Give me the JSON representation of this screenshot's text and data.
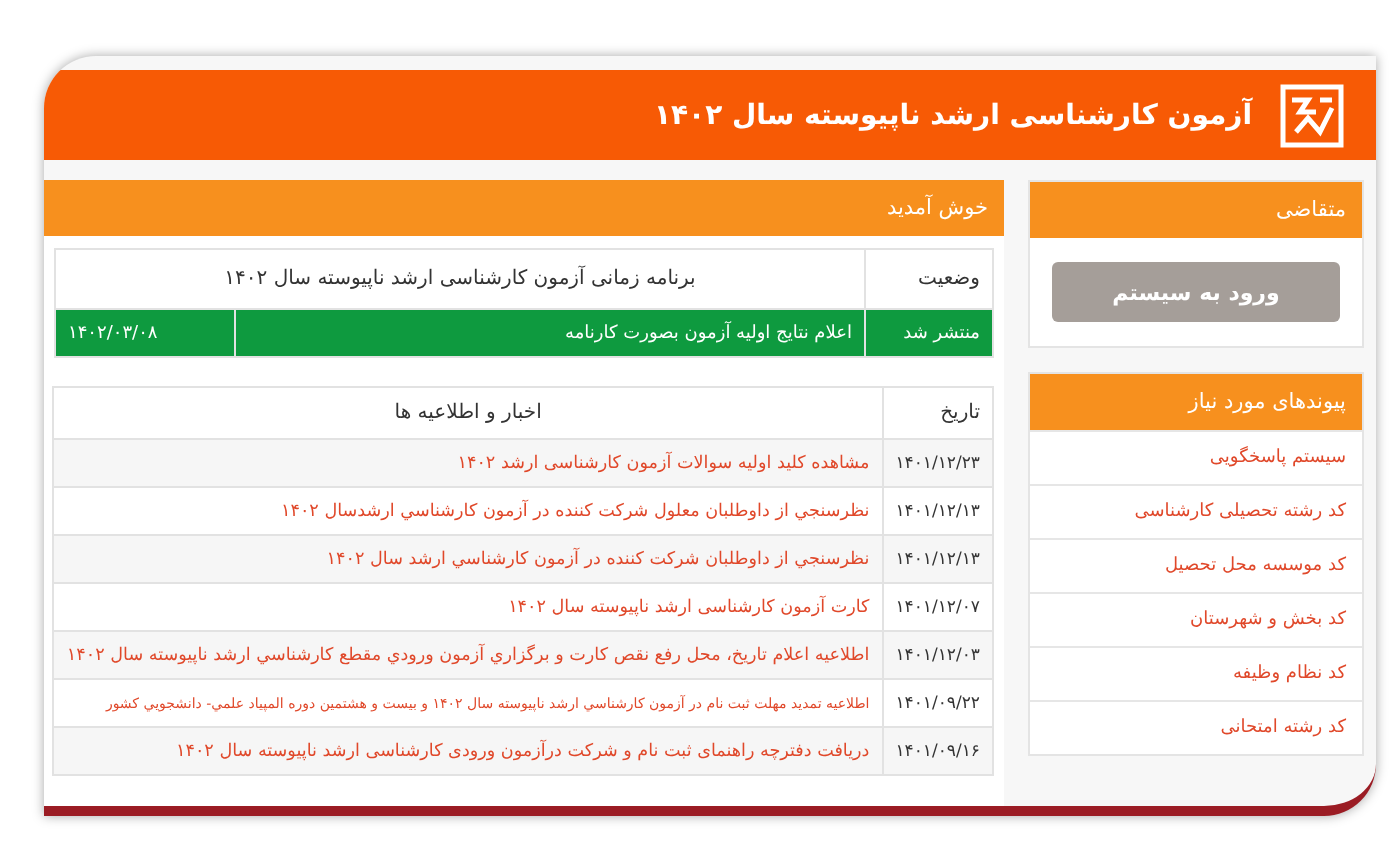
{
  "header": {
    "title": "آزمون کارشناسی ارشد ناپیوسته سال ۱۴۰۲"
  },
  "sidebar": {
    "applicant_panel": {
      "title": "متقاضی",
      "login_button": "ورود به سیستم"
    },
    "links_panel": {
      "title": "پیوندهای مورد نیاز",
      "links": [
        "سیستم پاسخگویی",
        "کد رشته تحصیلی کارشناسی",
        "کد موسسه محل تحصیل",
        "کد بخش و شهرستان",
        "کد نظام وظیفه",
        "کد رشته امتحانی"
      ]
    }
  },
  "main": {
    "title": "خوش آمدید",
    "schedule": {
      "status_label": "وضعیت",
      "heading": "برنامه زمانی آزمون کارشناسی ارشد ناپیوسته سال ۱۴۰۲",
      "rows": [
        {
          "status": "منتشر شد",
          "event": "اعلام نتایج اولیه آزمون بصورت کارنامه",
          "date": "۱۴۰۲/۰۳/۰۸",
          "published": true
        }
      ]
    },
    "news": {
      "columns": [
        "تاریخ",
        "اخبار و اطلاعیه ها"
      ],
      "rows": [
        {
          "date": "۱۴۰۱/۱۲/۲۳",
          "title": "مشاهده کلید اولیه سوالات آزمون کارشناسی ارشد ۱۴۰۲"
        },
        {
          "date": "۱۴۰۱/۱۲/۱۳",
          "title": "نظرسنجي از داوطلبان معلول شرکت کننده در آزمون کارشناسي ارشدسال ۱۴۰۲"
        },
        {
          "date": "۱۴۰۱/۱۲/۱۳",
          "title": "نظرسنجي از داوطلبان شركت كننده در آزمون كارشناسي ارشد سال ۱۴۰۲"
        },
        {
          "date": "۱۴۰۱/۱۲/۰۷",
          "title": "کارت آزمون کارشناسی ارشد ناپیوسته سال ۱۴۰۲"
        },
        {
          "date": "۱۴۰۱/۱۲/۰۳",
          "title": "اطلاعیه اعلام تاریخ، محل رفع نقص كارت و برگزاري آزمون ورودي مقطع كارشناسي ارشد ناپيوسته سال ۱۴۰۲"
        },
        {
          "date": "۱۴۰۱/۰۹/۲۲",
          "title": "اطلاعیه تمدید مهلت ثبت نام در آزمون کارشناسي ارشد ناپیوسته سال ۱۴۰۲ و بیست و هشتمین دوره المپیاد علمي- دانشجویي کشور"
        },
        {
          "date": "۱۴۰۱/۰۹/۱۶",
          "title": "دریافت دفترچه راهنمای ثبت نام و شرکت درآزمون ورودی کارشناسی ارشد ناپیوسته سال ۱۴۰۲"
        }
      ]
    }
  }
}
